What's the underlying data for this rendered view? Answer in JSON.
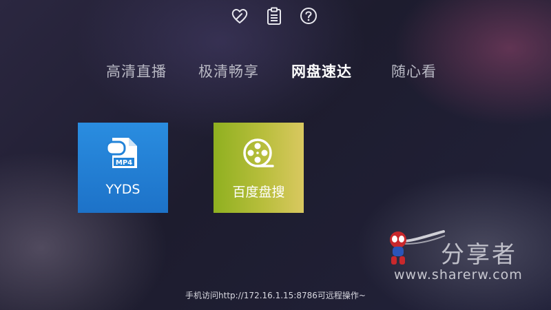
{
  "top_icons": [
    {
      "name": "favorite-heart-icon"
    },
    {
      "name": "clipboard-icon"
    },
    {
      "name": "help-question-icon"
    }
  ],
  "tabs": [
    {
      "label": "高清直播",
      "active": false
    },
    {
      "label": "极清畅享",
      "active": false
    },
    {
      "label": "网盘速达",
      "active": true
    },
    {
      "label": "随心看",
      "active": false
    }
  ],
  "tiles": [
    {
      "label": "YYDS",
      "icon": "mp4-file-icon",
      "icon_text": "MP4",
      "color": "#2283d8"
    },
    {
      "label": "百度盘搜",
      "icon": "film-reel-icon",
      "color": "#a8b82c"
    }
  ],
  "hint": "手机访问http://172.16.1.15:8786可远程操作~",
  "watermark": {
    "brand": "分享者",
    "url": "www.sharerw.com"
  }
}
